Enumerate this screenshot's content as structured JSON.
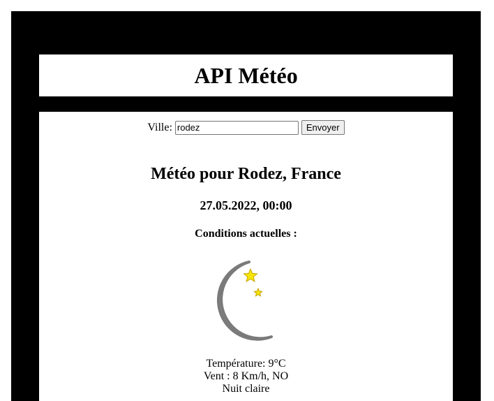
{
  "header": {
    "title": "API Météo"
  },
  "form": {
    "city_label": "Ville:",
    "city_value": "rodez",
    "submit_label": "Envoyer"
  },
  "weather": {
    "title": "Météo pour Rodez, France",
    "datetime": "27.05.2022, 00:00",
    "conditions_label": "Conditions actuelles :",
    "icon": "moon-stars-icon",
    "temperature": "Température: 9°C",
    "wind": "Vent : 8 Km/h, NO",
    "description": "Nuit claire"
  },
  "colors": {
    "frame": "#000000",
    "panel": "#ffffff",
    "moon": "#a9a9a9",
    "star": "#f5e60a"
  }
}
